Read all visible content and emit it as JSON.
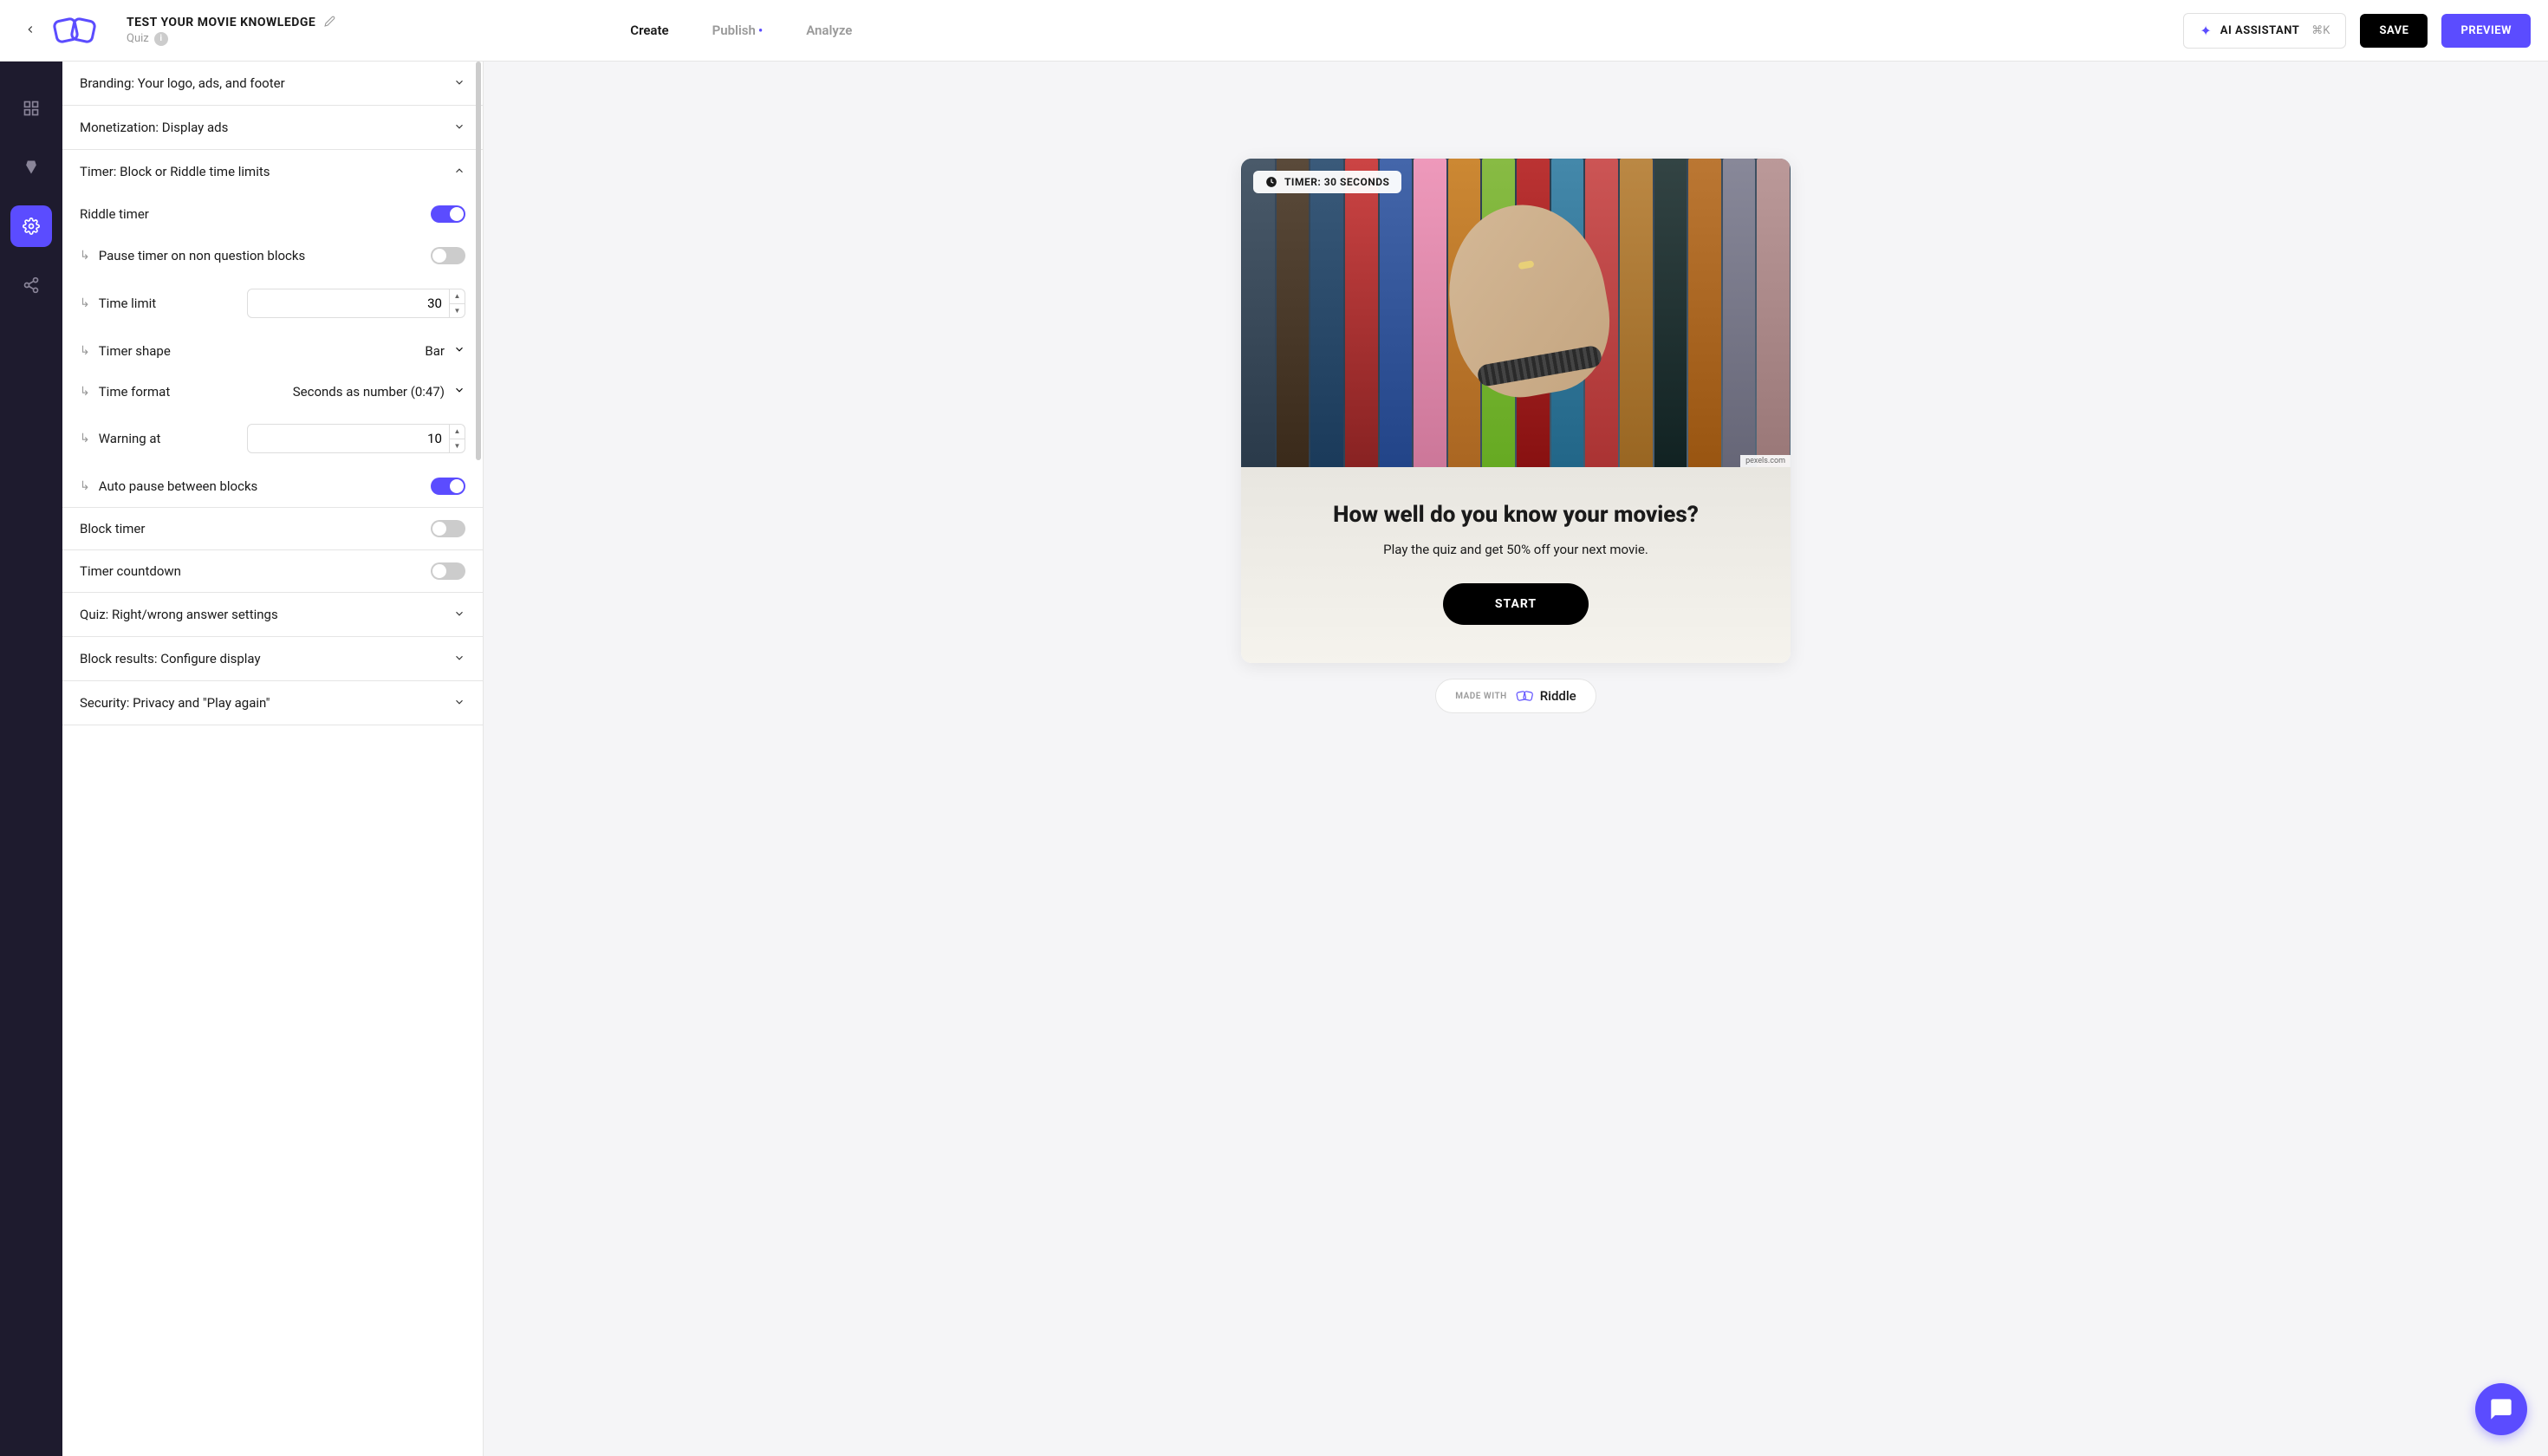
{
  "header": {
    "title": "TEST YOUR MOVIE KNOWLEDGE",
    "subtitle": "Quiz",
    "tabs": {
      "create": "Create",
      "publish": "Publish",
      "analyze": "Analyze"
    },
    "ai_label": "AI ASSISTANT",
    "ai_shortcut": "⌘K",
    "save_label": "SAVE",
    "preview_label": "PREVIEW"
  },
  "accordion": {
    "branding": "Branding: Your logo, ads, and footer",
    "monetization": "Monetization: Display ads",
    "timer": "Timer: Block or Riddle time limits",
    "quiz": "Quiz: Right/wrong answer settings",
    "block_results": "Block results: Configure display",
    "security": "Security: Privacy and \"Play again\""
  },
  "timer_settings": {
    "riddle_timer": "Riddle timer",
    "pause_timer": "Pause timer on non question blocks",
    "time_limit": "Time limit",
    "time_limit_value": "30",
    "timer_shape": "Timer shape",
    "timer_shape_value": "Bar",
    "time_format": "Time format",
    "time_format_value": "Seconds as number (0:47)",
    "warning_at": "Warning at",
    "warning_at_value": "10",
    "auto_pause": "Auto pause between blocks",
    "block_timer": "Block timer",
    "timer_countdown": "Timer countdown"
  },
  "preview": {
    "timer_chip": "TIMER: 30 SECONDS",
    "image_credit": "pexels.com",
    "headline": "How well do you know your movies?",
    "subtext": "Play the quiz and get 50% off your next movie.",
    "start_label": "START",
    "made_with": "MADE WITH",
    "riddle_brand": "Riddle"
  },
  "colors": {
    "primary": "#5b4cff",
    "dark": "#1e1b2e"
  }
}
